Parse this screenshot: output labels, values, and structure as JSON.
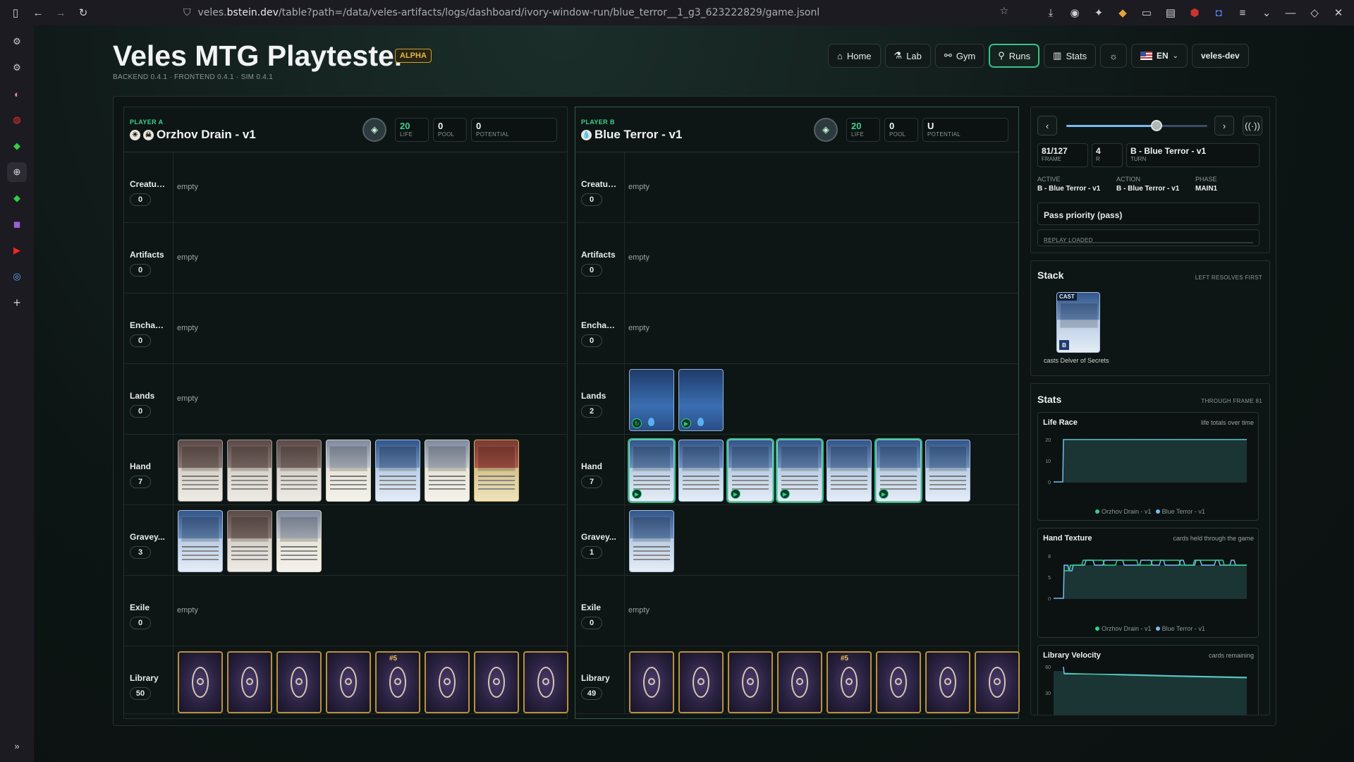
{
  "browser": {
    "url_prefix": "veles.",
    "url_host": "bstein.dev",
    "url_path": "/table?path=/data/veles-artifacts/logs/dashboard/ivory-window-run/blue_terror__1_g3_623222829/game.jsonl"
  },
  "app": {
    "title": "Veles MTG Playtester",
    "badge": "ALPHA",
    "versions": "BACKEND 0.4.1 · FRONTEND 0.4.1 · SIM 0.4.1"
  },
  "nav": {
    "home": "Home",
    "lab": "Lab",
    "gym": "Gym",
    "runs": "Runs",
    "stats": "Stats",
    "lang": "EN",
    "user": "veles-dev"
  },
  "empty_text": "empty",
  "players": [
    {
      "label": "PLAYER A",
      "name": "Orzhov Drain - v1",
      "life": "20",
      "life_key": "LIFE",
      "pool": "0",
      "pool_key": "POOL",
      "potential": "0",
      "potential_key": "POTENTIAL",
      "zones": {
        "creatures": {
          "label": "Creatures",
          "count": "0"
        },
        "artifacts": {
          "label": "Artifacts",
          "count": "0"
        },
        "enchants": {
          "label": "Enchants",
          "count": "0"
        },
        "lands": {
          "label": "Lands",
          "count": "0"
        },
        "hand": {
          "label": "Hand",
          "count": "7"
        },
        "graveyard": {
          "label": "Gravey...",
          "count": "3"
        },
        "exile": {
          "label": "Exile",
          "count": "0"
        },
        "library": {
          "label": "Library",
          "count": "50"
        }
      },
      "library_tag": "#5"
    },
    {
      "label": "PLAYER B",
      "name": "Blue Terror - v1",
      "life": "20",
      "life_key": "LIFE",
      "pool": "0",
      "pool_key": "POOL",
      "potential": "U",
      "potential_key": "POTENTIAL",
      "zones": {
        "creatures": {
          "label": "Creatures",
          "count": "0"
        },
        "artifacts": {
          "label": "Artifacts",
          "count": "0"
        },
        "enchants": {
          "label": "Enchants",
          "count": "0"
        },
        "lands": {
          "label": "Lands",
          "count": "2"
        },
        "hand": {
          "label": "Hand",
          "count": "7"
        },
        "graveyard": {
          "label": "Gravey...",
          "count": "1"
        },
        "exile": {
          "label": "Exile",
          "count": "0"
        },
        "library": {
          "label": "Library",
          "count": "49"
        }
      },
      "library_tag": "#5"
    }
  ],
  "replay": {
    "frame": "81/127",
    "frame_key": "FRAME",
    "round": "4",
    "round_key": "R",
    "turn": "B - Blue Terror - v1",
    "turn_key": "TURN",
    "progress": 0.64,
    "active_key": "ACTIVE",
    "active": "B - Blue Terror - v1",
    "action_key": "ACTION",
    "action": "B - Blue Terror - v1",
    "phase_key": "PHASE",
    "phase": "MAIN1",
    "action_text": "Pass priority (pass)",
    "status": "REPLAY LOADED"
  },
  "stack": {
    "title": "Stack",
    "note": "LEFT RESOLVES FIRST",
    "tag": "CAST",
    "owner": "B",
    "caption": "casts Delver of Secrets"
  },
  "stats": {
    "title": "Stats",
    "note": "THROUGH FRAME 81",
    "life_race": {
      "title": "Life Race",
      "subtitle": "life totals over time",
      "ticks": [
        "20",
        "10",
        "0"
      ]
    },
    "hand_texture": {
      "title": "Hand Texture",
      "subtitle": "cards held through the game",
      "ticks": [
        "8",
        "5",
        "0"
      ]
    },
    "library_velocity": {
      "title": "Library Velocity",
      "subtitle": "cards remaining",
      "ticks": [
        "60",
        "30"
      ]
    },
    "legend_a": "Orzhov Drain - v1",
    "legend_b": "Blue Terror - v1"
  },
  "colors": {
    "accent": "#39c28a",
    "series_a": "#2fd18a",
    "series_b": "#7ab9f2"
  }
}
